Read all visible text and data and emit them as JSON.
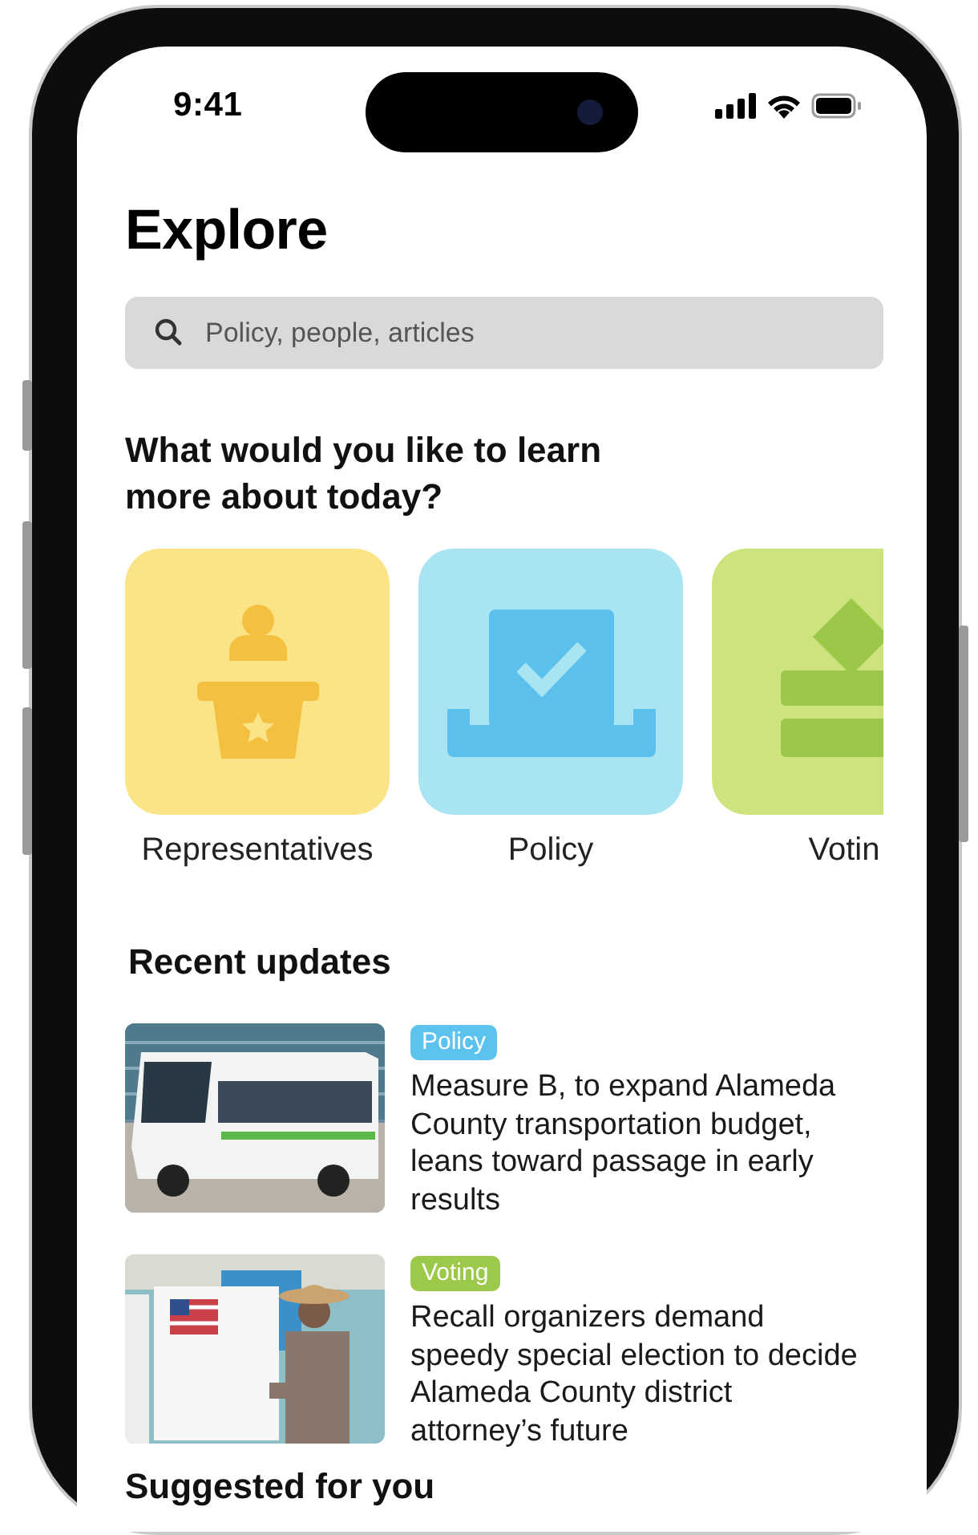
{
  "status_bar": {
    "time": "9:41"
  },
  "title": "Explore",
  "search": {
    "placeholder": "Policy, people, articles"
  },
  "prompt": "What would you like to learn more about today?",
  "categories": [
    {
      "label": "Representatives",
      "kind": "representatives",
      "color": "#fbe488"
    },
    {
      "label": "Policy",
      "kind": "policy",
      "color": "#a9e4f2"
    },
    {
      "label": "Votin",
      "kind": "voting",
      "color": "#cde47e"
    }
  ],
  "recent": {
    "heading": "Recent updates",
    "items": [
      {
        "tag": "Policy",
        "color": "#5cc2ee",
        "headline": "Measure B, to expand Alameda County transportation budget, leans toward passage in early results",
        "kind": "picture"
      },
      {
        "tag": "Voting",
        "color": "#9cc94a",
        "headline": "Recall organizers demand speedy special election to decide Alameda County district attorney’s future",
        "kind": "picture"
      }
    ]
  },
  "suggested": {
    "heading": "Suggested for you"
  }
}
